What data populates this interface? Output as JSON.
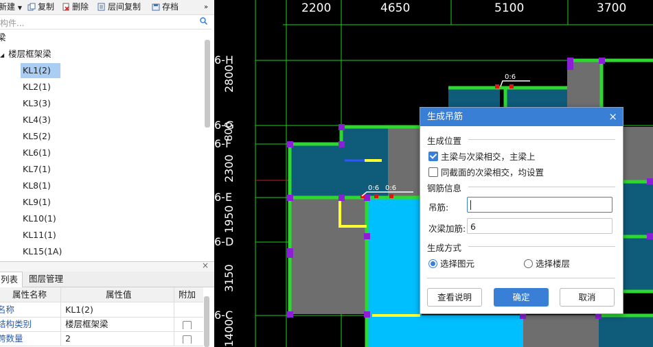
{
  "toolbar": {
    "items": [
      "新建",
      "复制",
      "删除",
      "层间复制",
      "存档"
    ],
    "more": "»"
  },
  "search": {
    "placeholder": "构件..."
  },
  "tree": {
    "root": "梁",
    "group": "楼层框架梁",
    "items": [
      "KL1(2)",
      "KL2(1)",
      "KL3(3)",
      "KL4(3)",
      "KL5(2)",
      "KL6(1)",
      "KL7(1)",
      "KL8(1)",
      "KL9(1)",
      "KL10(1)",
      "KL11(1)",
      "KL15(1A)"
    ],
    "selected_index": 0
  },
  "props": {
    "close": "×",
    "tabs": [
      "列表",
      "图层管理"
    ],
    "headers": [
      "属性名称",
      "属性值",
      "附加"
    ],
    "rows": [
      {
        "name": "名称",
        "value": "KL1(2)",
        "has_check": false
      },
      {
        "name": "结构类别",
        "value": "楼层框架梁",
        "has_check": true
      },
      {
        "name": "跨数量",
        "value": "2",
        "has_check": true
      }
    ]
  },
  "cad": {
    "top_dims": [
      "2200",
      "4650",
      "5100",
      "3700"
    ],
    "axis_labels": [
      "6-H",
      "6-G",
      "6-F",
      "6-E",
      "6-D",
      "6-C"
    ],
    "side_dims": [
      "2800",
      "800",
      "2300",
      "1950",
      "3150",
      "1400"
    ],
    "tags": [
      "0:6",
      "0:6",
      "0:6"
    ]
  },
  "dialog": {
    "title": "生成吊筋",
    "close": "×",
    "section_position": "生成位置",
    "opt_main_secondary": "主梁与次梁相交，主梁上",
    "opt_main_secondary_checked": true,
    "opt_same_section": "同截面的次梁相交，均设置",
    "opt_same_section_checked": false,
    "section_rebar": "钢筋信息",
    "field_hanger_label": "吊筋:",
    "field_hanger_value": "",
    "field_secondary_label": "次梁加筋:",
    "field_secondary_value": "6",
    "section_method": "生成方式",
    "radio_pick": "选择图元",
    "radio_pick_selected": true,
    "radio_floor": "选择楼层",
    "btn_help": "查看说明",
    "btn_ok": "确定",
    "btn_cancel": "取消"
  }
}
